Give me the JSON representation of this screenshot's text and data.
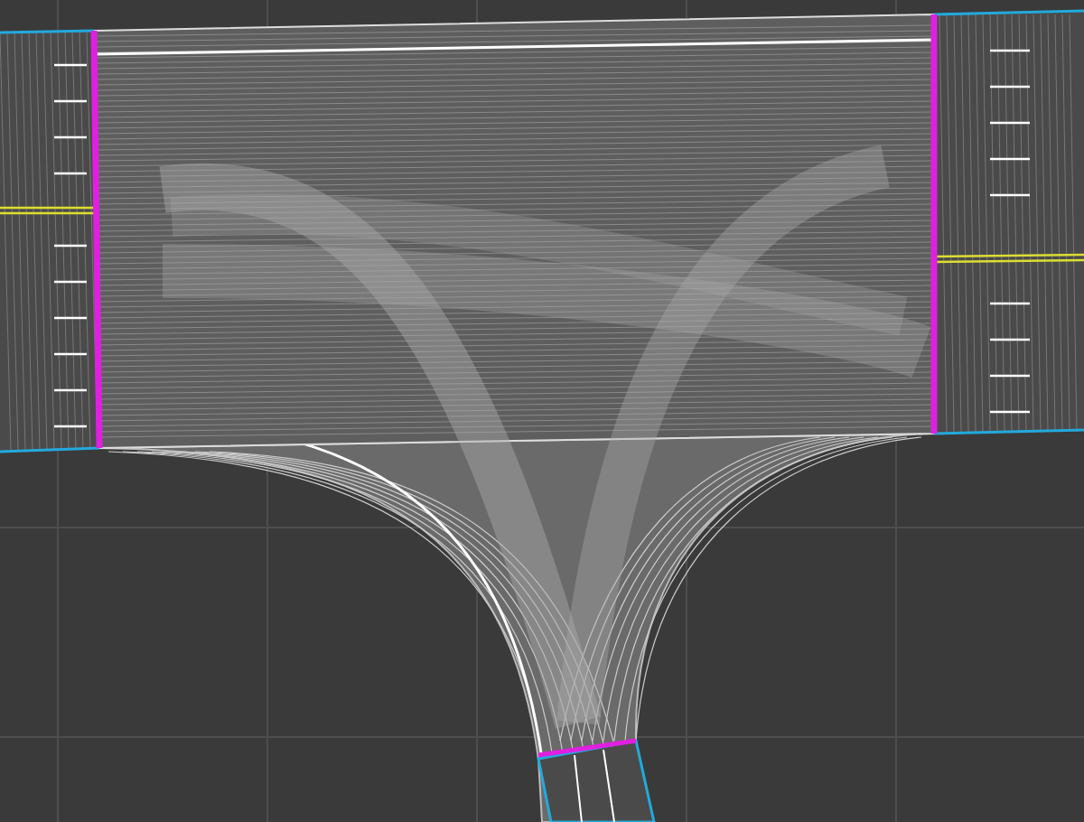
{
  "viewport": {
    "show_grid": true
  }
}
